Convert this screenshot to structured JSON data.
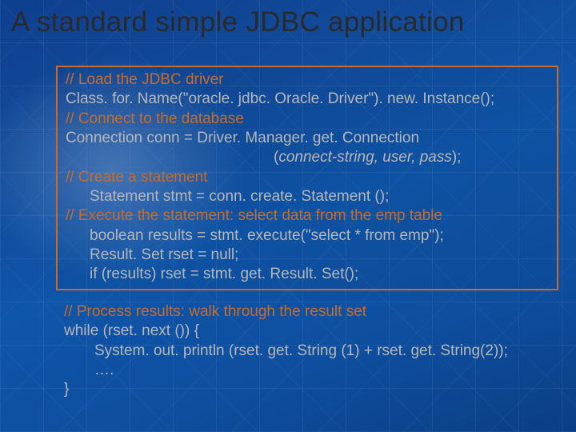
{
  "title": "A standard simple JDBC application",
  "box": {
    "c1": "// Load the JDBC driver",
    "l1": "Class. for. Name(\"oracle. jdbc. Oracle. Driver\"). new. Instance();",
    "c2": "// Connect to the database",
    "l2": "Connection conn = Driver. Manager. get. Connection",
    "l2b_open": "(",
    "l2b_args": "connect-string, user, pass",
    "l2b_close": ");",
    "c3": "// Create a statement",
    "l3": "Statement stmt = conn. create. Statement ();",
    "c4": "// Execute the statement: select data from the emp table",
    "l4": "boolean results = stmt. execute(\"select * from emp\");",
    "l5": "Result. Set rset = null;",
    "l6": "if (results) rset = stmt. get. Result. Set();"
  },
  "tail": {
    "c5": "//  Process results: walk through the result set",
    "l7": "while (rset. next ()) {",
    "l8": "System. out. println (rset. get. String (1) + rset. get. String(2));",
    "l9": "….",
    "l10": "}"
  }
}
